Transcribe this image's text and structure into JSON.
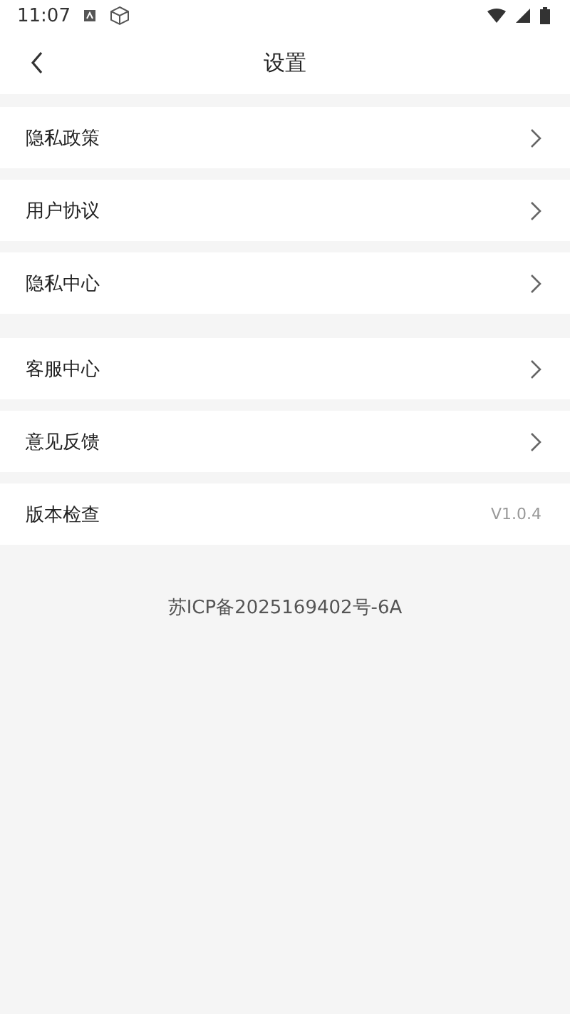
{
  "status_bar": {
    "time": "11:07"
  },
  "header": {
    "title": "设置"
  },
  "groups": [
    {
      "items": [
        {
          "kind": "link",
          "label": "隐私政策"
        },
        {
          "kind": "link",
          "label": "用户协议"
        },
        {
          "kind": "link",
          "label": "隐私中心"
        }
      ]
    },
    {
      "items": [
        {
          "kind": "link",
          "label": "客服中心"
        },
        {
          "kind": "link",
          "label": "意见反馈"
        },
        {
          "kind": "value",
          "label": "版本检查",
          "value": "V1.0.4"
        }
      ]
    }
  ],
  "footer": {
    "text": "苏ICP备2025169402号-6A"
  }
}
